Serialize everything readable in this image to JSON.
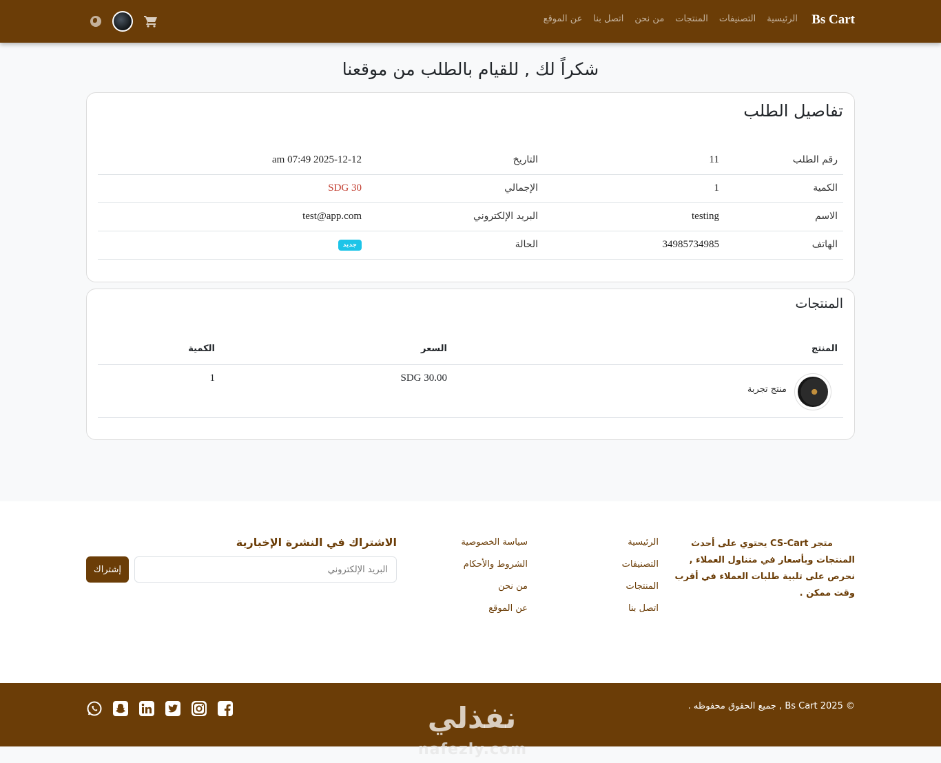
{
  "navbar": {
    "brand": "Bs Cart",
    "links": [
      "الرئيسية",
      "التصنيفات",
      "المنتجات",
      "من نحن",
      "اتصل بنا",
      "عن الموقع"
    ]
  },
  "page_title": "شكراً لك , للقيام بالطلب من موقعنا",
  "order_details": {
    "title": "تفاصيل الطلب",
    "rows": [
      {
        "label_a": "رقم الطلب",
        "value_a": "11",
        "label_b": "التاريخ",
        "value_b": "2025-12-12 07:49 am"
      },
      {
        "label_a": "الكمية",
        "value_a": "1",
        "label_b": "الإجمالي",
        "value_b": "30 SDG"
      },
      {
        "label_a": "الاسم",
        "value_a": "testing",
        "label_b": "البريد الإلكتروني",
        "value_b": "test@app.com"
      },
      {
        "label_a": "الهاتف",
        "value_a": "34985734985",
        "label_b": "الحالة",
        "value_b": "جديد"
      }
    ]
  },
  "products": {
    "title": "المنتجات",
    "headers": {
      "product": "المنتج",
      "price": "السعر",
      "quantity": "الكمية"
    },
    "items": [
      {
        "name": "منتج تجربة",
        "price": "SDG 30.00",
        "quantity": "1"
      }
    ]
  },
  "footer": {
    "about_title": "متجر CS-Cart يحتوي على أحدث",
    "about_text": "المنتجات وبأسعار في متناول العملاء , نحرص على تلبية طلبات العملاء في أقرب وقت ممكن .",
    "links_col1": [
      "الرئيسية",
      "التصنيفات",
      "المنتجات",
      "اتصل بنا"
    ],
    "links_col2": [
      "سياسة الخصوصية",
      "الشروط والأحكام",
      "من نحن",
      "عن الموقع"
    ],
    "newsletter_title": "الاشتراك في النشرة الإخبارية",
    "email_placeholder": "البريد الإلكتروني",
    "subscribe_label": "إشتراك",
    "copyright": "© 2025 Bs Cart , جميع الحقوق محفوظه ."
  },
  "watermark": {
    "main": "نفذلي",
    "sub": "nafezly.com"
  },
  "colors": {
    "brand": "#6b3d07",
    "badge": "#1cc4e8",
    "price": "#c0392b"
  }
}
